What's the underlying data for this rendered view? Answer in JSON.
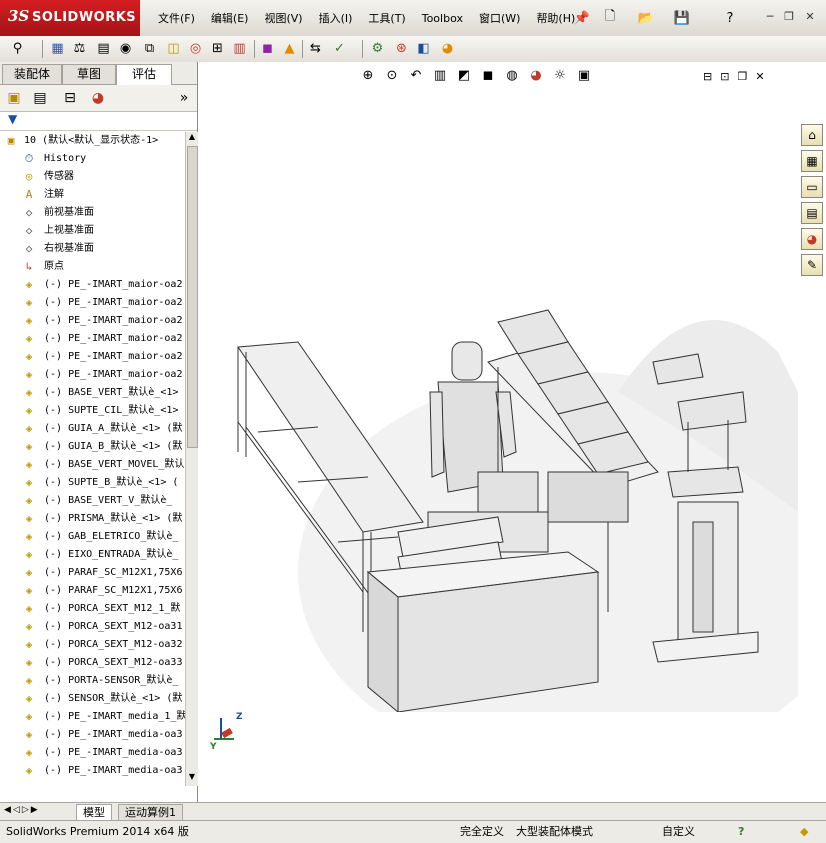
{
  "app": {
    "brand_mark": "3S",
    "brand_name": "SOLIDWORKS",
    "menu": [
      "文件(F)",
      "编辑(E)",
      "视图(V)",
      "插入(I)",
      "工具(T)",
      "Toolbox",
      "窗口(W)",
      "帮助(H)"
    ]
  },
  "feature_manager": {
    "tabs": [
      "装配体",
      "草图",
      "评估"
    ],
    "active_tab": "评估",
    "top_item": "10  (默认<默认_显示状态-1>",
    "items": [
      {
        "icon": "history-icon",
        "label": "History"
      },
      {
        "icon": "sensor-icon",
        "label": "传感器"
      },
      {
        "icon": "annotation-icon",
        "label": "注解"
      },
      {
        "icon": "plane-icon",
        "label": "前视基准面"
      },
      {
        "icon": "plane-icon",
        "label": "上视基准面"
      },
      {
        "icon": "plane-icon",
        "label": "右视基准面"
      },
      {
        "icon": "origin-icon",
        "label": "原点"
      },
      {
        "icon": "part-icon",
        "label": "(-) PE_-IMART_maior-oa2"
      },
      {
        "icon": "part-icon",
        "label": "(-) PE_-IMART_maior-oa2"
      },
      {
        "icon": "part-icon",
        "label": "(-) PE_-IMART_maior-oa2"
      },
      {
        "icon": "part-icon",
        "label": "(-) PE_-IMART_maior-oa2"
      },
      {
        "icon": "part-icon",
        "label": "(-) PE_-IMART_maior-oa2"
      },
      {
        "icon": "part-icon",
        "label": "(-) PE_-IMART_maior-oa2"
      },
      {
        "icon": "part-icon",
        "label": "(-) BASE_VERT_默认è_<1>"
      },
      {
        "icon": "part-icon",
        "label": "(-) SUPTE_CIL_默认è_<1>"
      },
      {
        "icon": "part-icon",
        "label": "(-) GUIA_A_默认è_<1> (默"
      },
      {
        "icon": "part-icon",
        "label": "(-) GUIA_B_默认è_<1> (默"
      },
      {
        "icon": "part-icon",
        "label": "(-) BASE_VERT_MOVEL_默认"
      },
      {
        "icon": "part-icon",
        "label": "(-) SUPTE_B_默认è_<1> ("
      },
      {
        "icon": "part-icon",
        "label": "(-) BASE_VERT_V_默认è_"
      },
      {
        "icon": "part-icon",
        "label": "(-) PRISMA_默认è_<1> (默"
      },
      {
        "icon": "part-icon",
        "label": "(-) GAB_ELETRICO_默认è_"
      },
      {
        "icon": "part-icon",
        "label": "(-) EIXO_ENTRADA_默认è_"
      },
      {
        "icon": "part-icon",
        "label": "(-) PARAF_SC_M12X1,75X6"
      },
      {
        "icon": "part-icon",
        "label": "(-) PARAF_SC_M12X1,75X6"
      },
      {
        "icon": "part-icon",
        "label": "(-) PORCA_SEXT_M12_1_默"
      },
      {
        "icon": "part-icon",
        "label": "(-) PORCA_SEXT_M12-oa31"
      },
      {
        "icon": "part-icon",
        "label": "(-) PORCA_SEXT_M12-oa32"
      },
      {
        "icon": "part-icon",
        "label": "(-) PORCA_SEXT_M12-oa33"
      },
      {
        "icon": "part-icon",
        "label": "(-) PORTA-SENSOR_默认è_"
      },
      {
        "icon": "part-icon",
        "label": "(-) SENSOR_默认è_<1> (默"
      },
      {
        "icon": "part-icon",
        "label": "(-) PE_-IMART_media_1_默"
      },
      {
        "icon": "part-icon",
        "label": "(-) PE_-IMART_media-oa3"
      },
      {
        "icon": "part-icon",
        "label": "(-) PE_-IMART_media-oa3"
      },
      {
        "icon": "part-icon",
        "label": "(-) PE_-IMART_media-oa3"
      }
    ]
  },
  "bottom_tabs": [
    "模型",
    "运动算例1"
  ],
  "status": {
    "product": "SolidWorks Premium 2014 x64 版",
    "definition": "完全定义",
    "mode": "大型装配体模式",
    "units": "自定义"
  },
  "colors": {
    "brand_red": "#c81b20",
    "background": "#d4d0c8"
  }
}
